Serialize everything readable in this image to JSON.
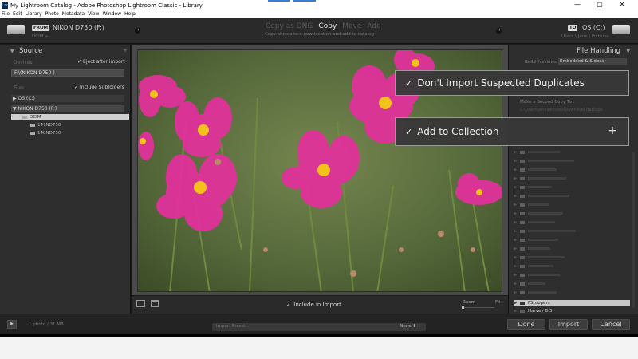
{
  "window": {
    "app_icon": "Lrc",
    "title": "My Lightroom Catalog - Adobe Photoshop Lightroom Classic - Library",
    "minimize": "—",
    "maximize": "▢",
    "close": "✕"
  },
  "menu": [
    "File",
    "Edit",
    "Library",
    "Photo",
    "Metadata",
    "View",
    "Window",
    "Help"
  ],
  "header": {
    "from_badge": "FROM",
    "from_device": "NIKON D750 (F:)",
    "from_path": "DCIM ÷",
    "modes": [
      "Copy as DNG",
      "Copy",
      "Move",
      "Add"
    ],
    "active_mode": "Copy",
    "mode_description": "Copy photos to a new location and add to catalog",
    "to_badge": "TO",
    "to_device": "OS (C:)",
    "to_path": "Users \\ Jane \\ Pictures"
  },
  "source_panel": {
    "title": "Source",
    "title_arrow": "▼",
    "plus": "+",
    "devices_label": "Devices",
    "eject_label": "Eject after import",
    "device_value": "F:\\(NIKON D750 )",
    "files_label": "Files",
    "include_subfolders_label": "Include Subfolders",
    "drives": [
      {
        "arrow": "▶",
        "label": "OS (C:)"
      },
      {
        "arrow": "▼",
        "label": "NIKON D750 (F:)"
      }
    ],
    "folders": [
      {
        "label": "DCIM",
        "selected": true
      },
      {
        "label": "147ND750",
        "selected": false
      },
      {
        "label": "148ND750",
        "selected": false
      }
    ]
  },
  "file_handling_panel": {
    "title": "File Handling",
    "title_arrow": "▼",
    "build_previews_label": "Build Previews",
    "build_previews_value": "Embedded & Sidecar",
    "second_copy_label": "Make a Second Copy To :",
    "second_copy_path": "C:\\Users\\Jane\\Pictures\\Download Backups",
    "collections": [
      {
        "name": "FStoppers",
        "selected": true
      },
      {
        "name": "Harvey B-5",
        "selected": false
      }
    ]
  },
  "callouts": {
    "duplicates": "Don't Import Suspected Duplicates",
    "add_collection": "Add to Collection",
    "check": "✓",
    "plus": "+"
  },
  "toolbar": {
    "include_in_import": "Include in Import",
    "check": "✓",
    "zoom_label": "Zoom",
    "fit_label": "Fit"
  },
  "bottom": {
    "expand_icon": "▶",
    "photo_count": "1 photo / 31 MB",
    "import_preset_label": "Import Preset :",
    "import_preset_value": "None ⬍",
    "done": "Done",
    "import": "Import",
    "cancel": "Cancel"
  },
  "colors": {
    "panel_bg": "#2e2e2e",
    "center_bg": "#4a4a4a",
    "selection": "#cfcfcf",
    "flower_pink": "#e0329a"
  }
}
